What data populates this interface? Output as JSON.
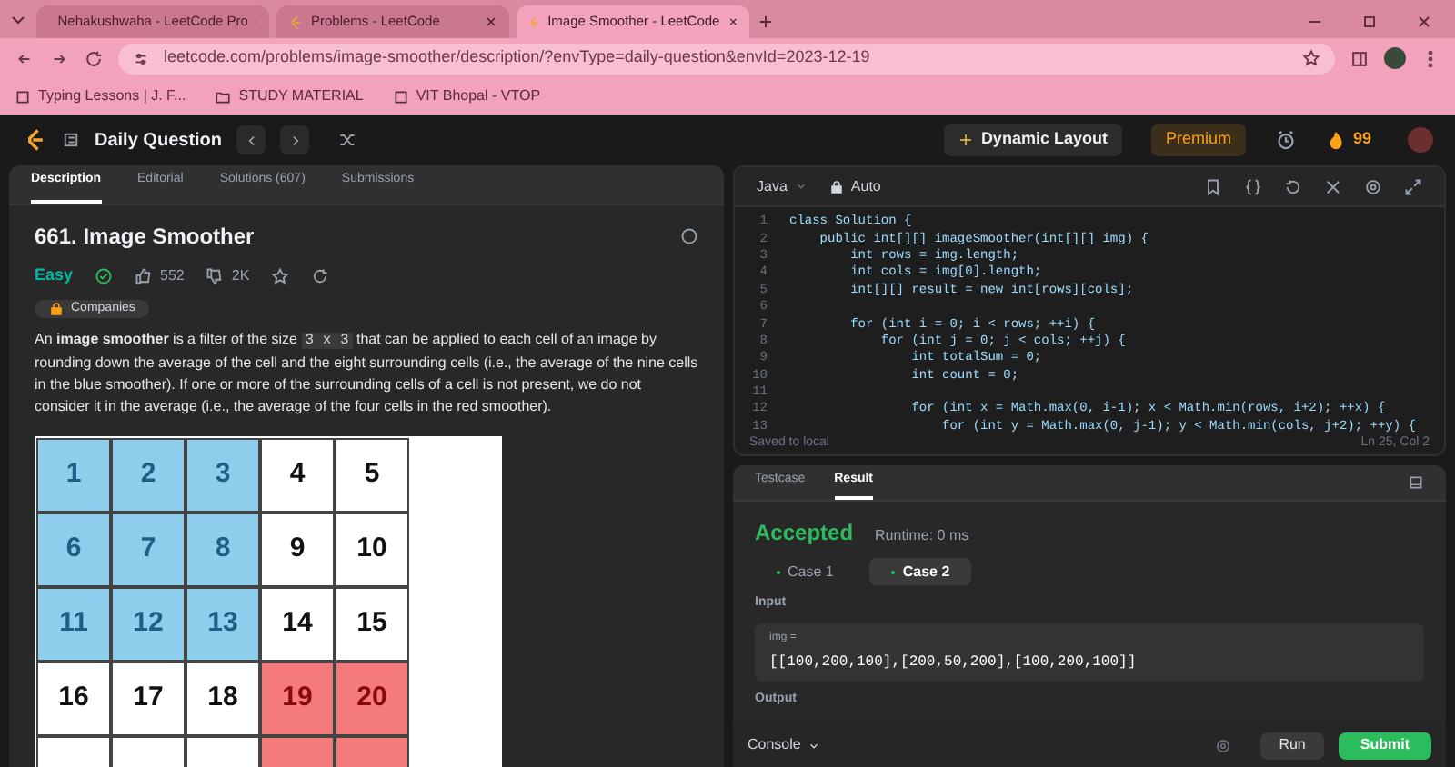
{
  "browser": {
    "tabs": [
      {
        "title": "Nehakushwaha - LeetCode Pro",
        "selected": false
      },
      {
        "title": "Problems - LeetCode",
        "selected": false
      },
      {
        "title": "Image Smoother - LeetCode",
        "selected": true
      }
    ],
    "url": "leetcode.com/problems/image-smoother/description/?envType=daily-question&envId=2023-12-19",
    "bookmarks": [
      "Typing Lessons | J. F...",
      "STUDY MATERIAL",
      "VIT Bhopal - VTOP"
    ]
  },
  "nav": {
    "title": "Daily Question",
    "layout_button": "Dynamic Layout",
    "premium": "Premium",
    "streak": "99"
  },
  "left": {
    "tabs": [
      {
        "label": "Description",
        "selected": true
      },
      {
        "label": "Editorial",
        "selected": false
      },
      {
        "label": "Solutions (607)",
        "selected": false
      },
      {
        "label": "Submissions",
        "selected": false
      }
    ],
    "title": "661. Image Smoother",
    "difficulty": "Easy",
    "likes": "552",
    "dislikes": "2K",
    "companies": "Companies",
    "description": {
      "before": "An **image smoother** is a filter of the size",
      "code": "3 x 3",
      "after": "that can be applied to each cell of an image by rounding down the average of the cell and the eight surrounding cells (i.e., the average of the nine cells in the blue smoother). If one or more of the surrounding cells of a cell is not present, we do not consider it in the average (i.e., the average of the four cells in the red smoother)."
    },
    "grid": [
      [
        {
          "text": "1",
          "color": "#8ecdec"
        },
        {
          "text": "2",
          "color": "#8ecdec"
        },
        {
          "text": "3",
          "color": "#8ecdec"
        },
        {
          "text": "4",
          "color": "#ffffff"
        },
        {
          "text": "5",
          "color": "#ffffff"
        }
      ],
      [
        {
          "text": "6",
          "color": "#8ecdec"
        },
        {
          "text": "7",
          "color": "#8ecdec"
        },
        {
          "text": "8",
          "color": "#8ecdec"
        },
        {
          "text": "9",
          "color": "#ffffff"
        },
        {
          "text": "10",
          "color": "#ffffff"
        }
      ],
      [
        {
          "text": "11",
          "color": "#8ecdec"
        },
        {
          "text": "12",
          "color": "#8ecdec"
        },
        {
          "text": "13",
          "color": "#8ecdec"
        },
        {
          "text": "14",
          "color": "#ffffff"
        },
        {
          "text": "15",
          "color": "#ffffff"
        }
      ],
      [
        {
          "text": "16",
          "color": "#ffffff"
        },
        {
          "text": "17",
          "color": "#ffffff"
        },
        {
          "text": "18",
          "color": "#ffffff"
        },
        {
          "text": "19",
          "color": "#f57a7a"
        },
        {
          "text": "20",
          "color": "#f57a7a"
        }
      ],
      [
        {
          "color": "#ffffff"
        },
        {
          "color": "#ffffff"
        },
        {
          "color": "#ffffff"
        },
        {
          "color": "#f57a7a"
        },
        {
          "color": "#f57a7a"
        }
      ]
    ]
  },
  "editor": {
    "language": "Java",
    "mode": "Auto",
    "lines": [
      {
        "number": "1",
        "code": "class Solution {"
      },
      {
        "number": "2",
        "code": "    public int[][] imageSmoother(int[][] img) {"
      },
      {
        "number": "3",
        "code": "        int rows = img.length;"
      },
      {
        "number": "4",
        "code": "        int cols = img[0].length;"
      },
      {
        "number": "5",
        "code": "        int[][] result = new int[rows][cols];"
      },
      {
        "number": "6"
      },
      {
        "number": "7",
        "code": "        for (int i = 0; i < rows; ++i) {"
      },
      {
        "number": "8",
        "code": "            for (int j = 0; j < cols; ++j) {"
      },
      {
        "number": "9",
        "code": "                int totalSum = 0;"
      },
      {
        "number": "10",
        "code": "                int count = 0;"
      },
      {
        "number": "11"
      },
      {
        "number": "12",
        "code": "                for (int x = Math.max(0, i-1); x < Math.min(rows, i+2); ++x) {"
      },
      {
        "number": "13",
        "code": "                    for (int y = Math.max(0, j-1); y < Math.min(cols, j+2); ++y) {"
      }
    ],
    "saved": "Saved to local",
    "position": "Ln 25, Col 2"
  },
  "result": {
    "tabs": [
      {
        "label": "Testcase",
        "selected": false
      },
      {
        "label": "Result",
        "selected": true
      }
    ],
    "status": "Accepted",
    "runtime": "Runtime: 0 ms",
    "cases": [
      {
        "label": "Case 1",
        "selected": false
      },
      {
        "label": "Case 2",
        "selected": true
      }
    ],
    "input_label": "Input",
    "var": "img =",
    "value": "[[100,200,100],[200,50,200],[100,200,100]]",
    "output_label": "Output",
    "console": "Console",
    "run": "Run",
    "submit": "Submit"
  }
}
